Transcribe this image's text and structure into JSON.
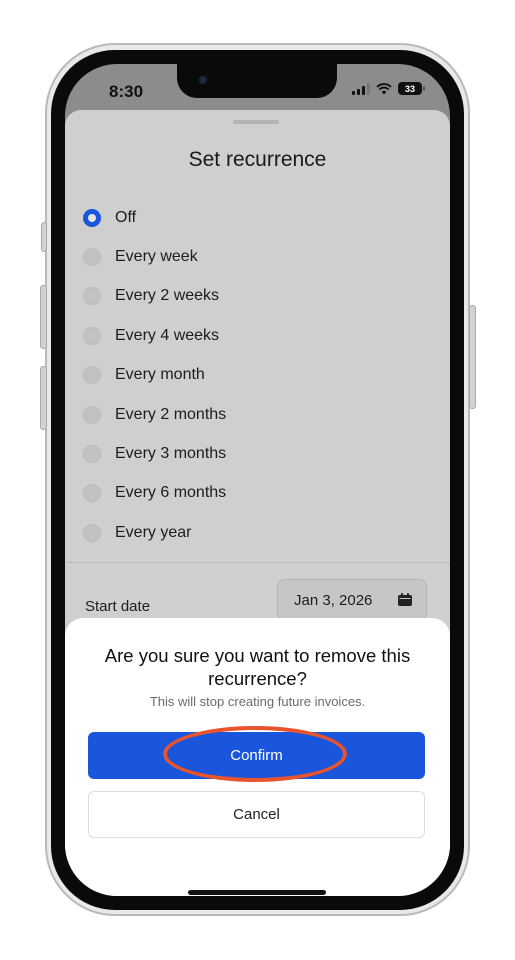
{
  "status_bar": {
    "time": "8:30",
    "battery": "33"
  },
  "sheet": {
    "title": "Set recurrence",
    "options": [
      {
        "label": "Off",
        "selected": true
      },
      {
        "label": "Every week",
        "selected": false
      },
      {
        "label": "Every 2 weeks",
        "selected": false
      },
      {
        "label": "Every 4 weeks",
        "selected": false
      },
      {
        "label": "Every month",
        "selected": false
      },
      {
        "label": "Every 2 months",
        "selected": false
      },
      {
        "label": "Every 3 months",
        "selected": false
      },
      {
        "label": "Every 6 months",
        "selected": false
      },
      {
        "label": "Every year",
        "selected": false
      }
    ],
    "start_date_label": "Start date",
    "start_date_value": "Jan 3, 2026"
  },
  "dialog": {
    "title": "Are you sure you want to remove this recurrence?",
    "subtitle": "This will stop creating future invoices.",
    "confirm_label": "Confirm",
    "cancel_label": "Cancel"
  },
  "colors": {
    "accent": "#1a56db",
    "highlight": "#e8542e"
  }
}
